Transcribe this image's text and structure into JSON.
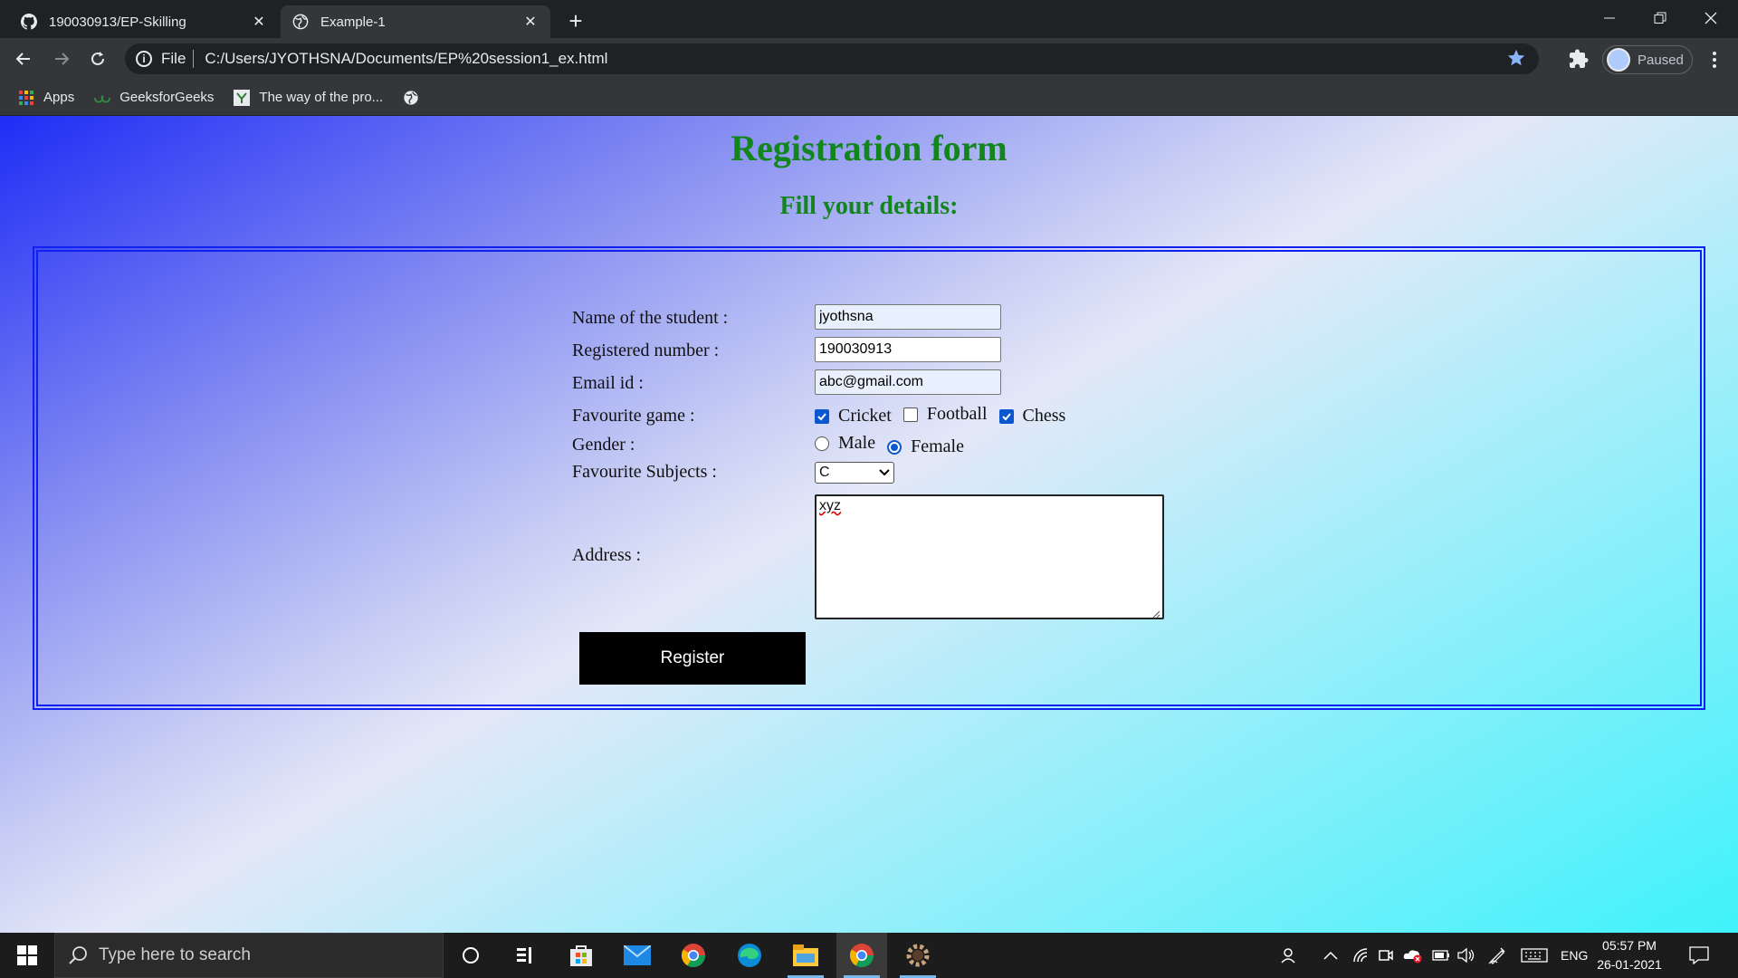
{
  "browser": {
    "tabs": [
      {
        "title": "190030913/EP-Skilling",
        "icon": "github-icon",
        "active": false
      },
      {
        "title": "Example-1",
        "icon": "globe-icon",
        "active": true
      }
    ],
    "address": {
      "scheme_label": "File",
      "url": "C:/Users/JYOTHSNA/Documents/EP%20session1_ex.html"
    },
    "profile_label": "Paused",
    "bookmarks": [
      {
        "label": "Apps",
        "icon": "apps-grid-icon"
      },
      {
        "label": "GeeksforGeeks",
        "icon": "geeksforgeeks-icon"
      },
      {
        "label": "The way of the pro...",
        "icon": "bookmark-site-icon"
      },
      {
        "label": "",
        "icon": "globe-icon"
      }
    ]
  },
  "page": {
    "title": "Registration form",
    "subtitle": "Fill your details:",
    "form": {
      "name_label": "Name of the student :",
      "name_value": "jyothsna",
      "regno_label": "Registered number :",
      "regno_value": "190030913",
      "email_label": "Email id :",
      "email_value": "abc@gmail.com",
      "game_label": "Favourite game :",
      "games": [
        {
          "label": "Cricket",
          "checked": true
        },
        {
          "label": "Football",
          "checked": false
        },
        {
          "label": "Chess",
          "checked": true
        }
      ],
      "gender_label": "Gender :",
      "genders": [
        {
          "label": "Male",
          "selected": false
        },
        {
          "label": "Female",
          "selected": true
        }
      ],
      "subjects_label": "Favourite Subjects :",
      "subjects_selected": "C",
      "address_label": "Address :",
      "address_value": "xyz",
      "register_label": "Register"
    }
  },
  "taskbar": {
    "search_placeholder": "Type here to search",
    "language": "ENG",
    "time": "05:57 PM",
    "date": "26-01-2021"
  },
  "colors": {
    "heading_green": "#13851d",
    "border_blue": "#1020ee",
    "button_black": "#000000"
  }
}
